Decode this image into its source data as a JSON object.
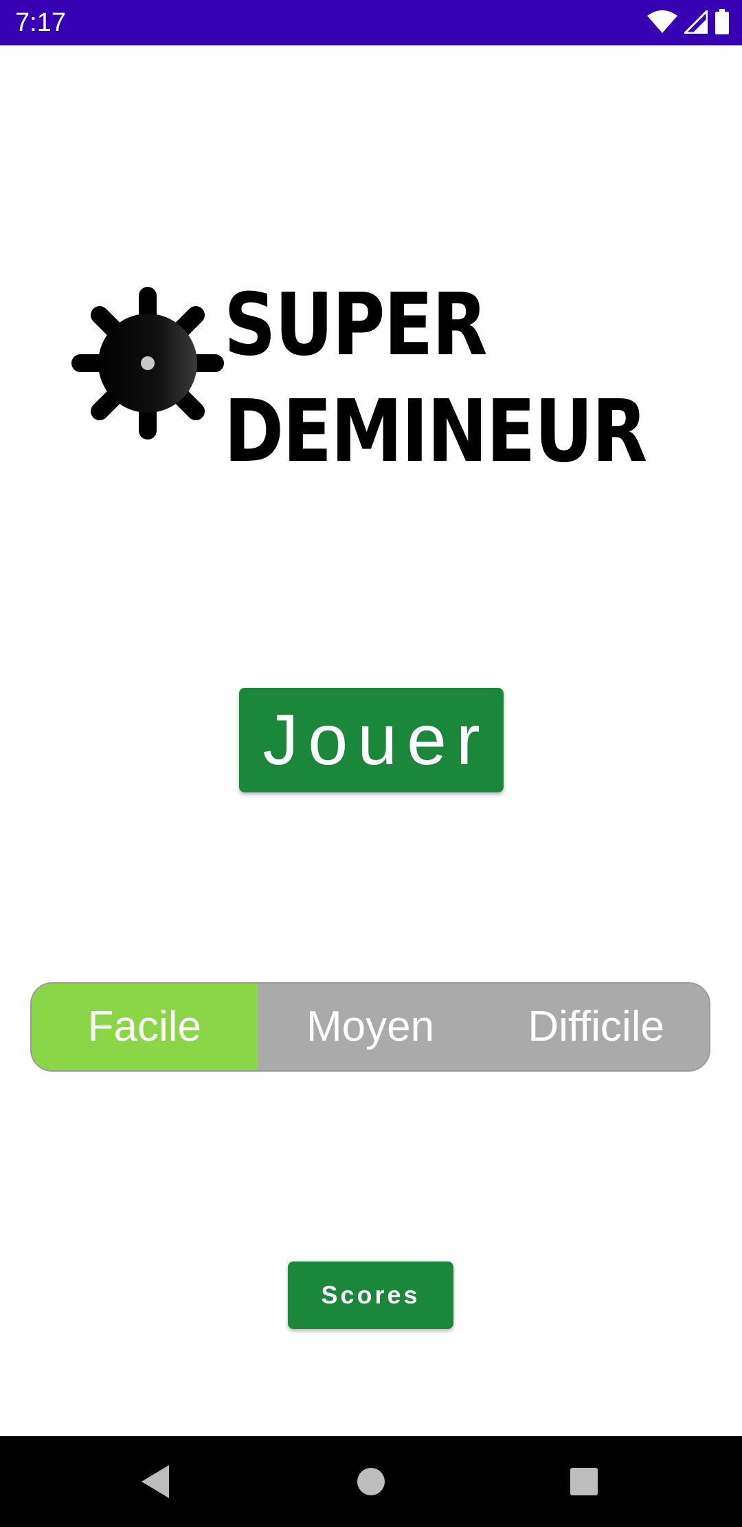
{
  "status_bar": {
    "time": "7:17",
    "icons": [
      "wifi-icon",
      "cellular-signal-icon",
      "battery-icon"
    ]
  },
  "logo": {
    "icon": "mine-icon",
    "title_line1": "SUPER",
    "title_line2": "DEMINEUR"
  },
  "main": {
    "play_label": "Jouer",
    "difficulty": {
      "options": [
        "Facile",
        "Moyen",
        "Difficile"
      ],
      "selected": "Facile"
    },
    "scores_label": "Scores"
  },
  "nav_bar": {
    "icons": [
      "back-icon",
      "home-icon",
      "recents-icon"
    ]
  },
  "colors": {
    "status_bar": "#3700b3",
    "button_green": "#1b873a",
    "selected_segment": "#8bd646",
    "segment_gray": "#aaaaaa"
  }
}
